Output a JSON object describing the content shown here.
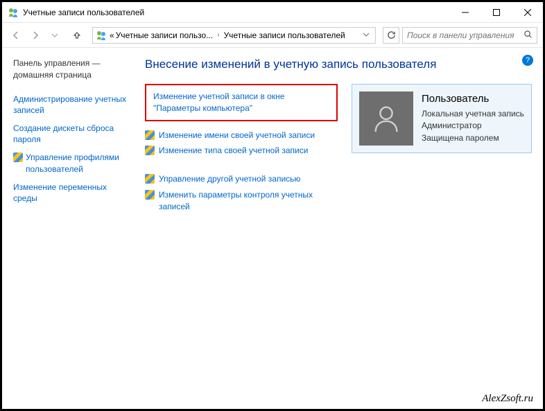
{
  "window": {
    "title": "Учетные записи пользователей"
  },
  "breadcrumb": {
    "prefix": "«",
    "item1": "Учетные записи пользо...",
    "item2": "Учетные записи пользователей"
  },
  "search": {
    "placeholder": "Поиск в панели управления"
  },
  "sidebar": {
    "home": "Панель управления — домашняя страница",
    "items": [
      "Администрирование учетных записей",
      "Создание дискеты сброса пароля",
      "Управление профилями пользователей",
      "Изменение переменных среды"
    ]
  },
  "main": {
    "heading": "Внесение изменений в учетную запись пользователя",
    "highlighted_link": "Изменение учетной записи в окне \"Параметры компьютера\"",
    "group1": [
      "Изменение имени своей учетной записи",
      "Изменение типа своей учетной записи"
    ],
    "group2": [
      "Управление другой учетной записью",
      "Изменить параметры контроля учетных записей"
    ]
  },
  "user": {
    "name": "Пользователь",
    "type": "Локальная учетная запись",
    "role": "Администратор",
    "protection": "Защищена паролем"
  },
  "watermark": "AlexZsoft.ru",
  "help": "?"
}
